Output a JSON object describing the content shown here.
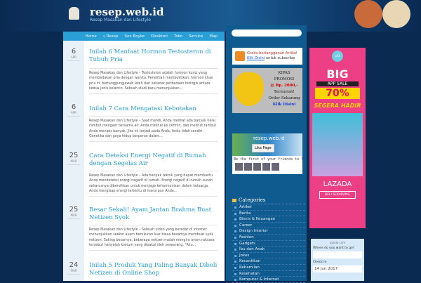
{
  "header": {
    "title": "resep.web.id",
    "tagline": "Resep Masakan dan Lifestyle"
  },
  "nav": [
    "Home",
    "» Resep",
    "Sex Boyke",
    "Direktori",
    "Toko",
    "Service",
    "Map"
  ],
  "posts": [
    {
      "day": "6",
      "mon": "APR",
      "title": "Inilah 6 Manfaat Hormon Testosteron di Tubuh Pria",
      "excerpt": "Resep Masakan dan Lifestyle – Testosteron adalah hormon kunci yang membedakan pria dengan wanita. Penelitian membuktikan, hormon khas pria ini bertanggungjawab lebih dari sekadar perbedaan biologis antara kedua jenis kelamin. Sebuah studi baru menunjukkan..."
    },
    {
      "day": "6",
      "mon": "APR",
      "title": "Inilah 7 Cara Mengatasi Kebotakan",
      "excerpt": "Resep Masakan dan Lifestyle – Saat mandi, Anda melihat ada banyak helai rambut mengalir bersama air. Anda melihat ke cermin, dan melihat rambut Anda menipis banyak. Jika ini terjadi pada Anda, Anda tidak sendiri. Genetika dan gaya hidup berperan dalam..."
    },
    {
      "day": "25",
      "mon": "MAR",
      "title": "Cara Deteksi Energi Negatif di Rumah dengan Segelas Air",
      "excerpt": "Resep Masakan dan Lifestyle – Ada banyak teknik yang dapat membantu Anda mendeteksi energi negatif di rumah. Energi negatif di rumah sudah seharusnya dibersihkan untuk menjaga keharmonisan dalam keluarga. Anda mengisap energi tertentu di mana pun Anda..."
    },
    {
      "day": "25",
      "mon": "MAR",
      "title": "Besar Sekali! Ayam Jantan Brahma Buat Netizen Syok",
      "excerpt": "Resep Masakan dan Lifestyle – Sebuah video yang beredar di internet menunjukkan seekor ayam berukuran luar biasa besarnya membuat syok netizen. Saking besarnya, beberapa netizen malah mengira ayam raksasa tersebut hanyalah kostum yang dipakai oleh seseorang. \"Aku..."
    },
    {
      "day": "24",
      "mon": "MAR",
      "title": "Inilah 5 Produk Yang Paling Banyak Dibeli Netizen di Online Shop"
    }
  ],
  "rss": {
    "text": "Gratis berlangganan Artikel",
    "link": "Klik Disini",
    "suffix": " untuk subscribe"
  },
  "kipas": [
    "KIPAS",
    "PROMOSI",
    "@ Rp. 2000,-",
    "Termurah!",
    "Order Sekarang",
    "Klik Disini"
  ],
  "fb": {
    "name": "resep.web.id",
    "like": "Like Page",
    "friends": "Be the first of your friends to like this"
  },
  "categories": {
    "title": "Categories",
    "items": [
      "Artikel",
      "Berita",
      "Bisnis & Keuangan",
      "Career",
      "Design Interior",
      "Fashion",
      "Gadgets",
      "Ibu dan Anak",
      "Jokes",
      "Kecantikan",
      "Kehamilan",
      "Kesehatan",
      "Komputer & Internet"
    ]
  },
  "lazada": {
    "logo": "LAZ",
    "big": "BIG",
    "sale": "APP SALE",
    "pct": "70%",
    "segera": "SEGERA HADIR",
    "brand": "LAZADA",
    "buy": "BELI SEKARANG"
  },
  "hotel": {
    "brand": "agoda.com",
    "where": "Where do you want to go?",
    "checkin": "Check In",
    "date": "14 Jun 2017"
  }
}
